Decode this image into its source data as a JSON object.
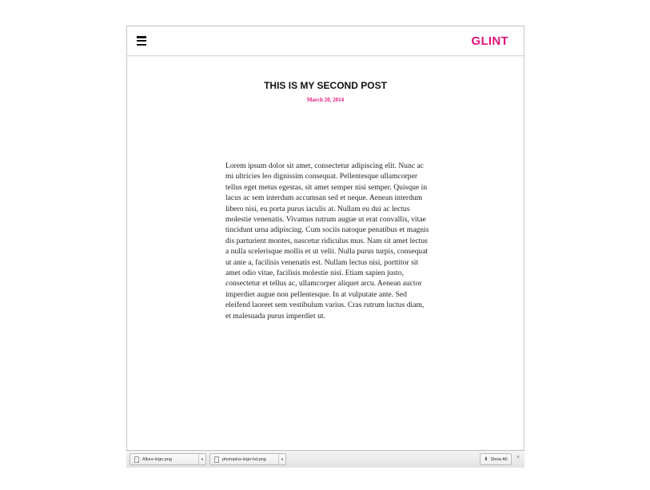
{
  "header": {
    "menu_icon": "hamburger-icon",
    "brand": "GLINT",
    "brand_color": "#e5157a"
  },
  "post": {
    "title": "THIS IS MY SECOND POST",
    "date": "March 20, 2014",
    "body": "Lorem ipsum dolor sit amet, consectetur adipiscing elit. Nunc ac mi ultricies leo dignissim consequat. Pellentesque ullamcorper tellus eget metus egestas, sit amet semper nisi semper. Quisque in lacus ac sem interdum accumsan sed et neque. Aenean interdum libero nisi, eu porta purus iaculis at. Nullam eu dui ac lectus molestie venenatis. Vivamus rutrum augue ut erat convallis, vitae tincidunt urna adipiscing. Cum sociis natoque penatibus et magnis dis parturient montes, nascetur ridiculus mus. Nam sit amet lectus a nulla scelerisque mollis et ut velit. Nulla purus turpis, consequat ut ante a, facilisis venenatis est. Nullam lectus nisi, porttitor sit amet odio vitae, facilisis molestie nisi. Etiam sapien justo, consectetur et tellus ac, ullamcorper aliquet arcu. Aenean auctor imperdiet augue non pellentesque. In at vulputate ante. Sed eleifend laoreet sem vestibulum varius. Cras rutrum luctus diam, et malesuada purus imperdiet ut."
  },
  "downloads": {
    "items": [
      {
        "filename": "Allure-logo.png"
      },
      {
        "filename": "photoplus-logo-hd.png"
      }
    ],
    "show_all": "Show All",
    "close": "×"
  }
}
